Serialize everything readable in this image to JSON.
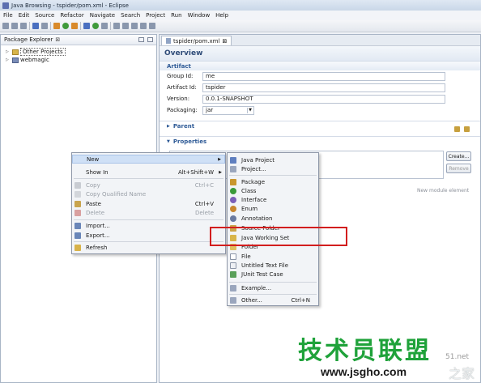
{
  "window": {
    "title": "Java Browsing - tspider/pom.xml - Eclipse"
  },
  "menubar": [
    "File",
    "Edit",
    "Source",
    "Refactor",
    "Navigate",
    "Search",
    "Project",
    "Run",
    "Window",
    "Help"
  ],
  "explorer": {
    "title": "Package Explorer",
    "close": "⊠",
    "tree": [
      {
        "label": "Other Projects",
        "selected": true
      },
      {
        "label": "webmagic",
        "selected": false
      }
    ]
  },
  "editor": {
    "tab": {
      "label": "tspider/pom.xml",
      "close": "⊠"
    },
    "heading": "Overview",
    "artifact": {
      "title": "Artifact",
      "group_id_label": "Group Id:",
      "group_id_value": "me",
      "artifact_id_label": "Artifact Id:",
      "artifact_id_value": "tspider",
      "version_label": "Version:",
      "version_value": "0.0.1-SNAPSHOT",
      "packaging_label": "Packaging:",
      "packaging_value": "jar"
    },
    "parent_title": "Parent",
    "properties_title": "Properties",
    "create_btn": "Create...",
    "remove_btn": "Remove",
    "new_module_hint": "New module element"
  },
  "context_menu": {
    "items": [
      {
        "label": "New",
        "submenu": true
      },
      {
        "label": "Show In",
        "accel": "Alt+Shift+W",
        "submenu": true
      },
      {
        "label": "Copy",
        "accel": "Ctrl+C",
        "disabled": true
      },
      {
        "label": "Copy Qualified Name",
        "disabled": true
      },
      {
        "label": "Paste",
        "accel": "Ctrl+V"
      },
      {
        "label": "Delete",
        "accel": "Delete",
        "disabled": true
      },
      {
        "label": "Import..."
      },
      {
        "label": "Export..."
      },
      {
        "label": "Refresh"
      }
    ]
  },
  "new_submenu": {
    "items": [
      {
        "label": "Java Project"
      },
      {
        "label": "Project..."
      },
      {
        "label": "Package"
      },
      {
        "label": "Class"
      },
      {
        "label": "Interface"
      },
      {
        "label": "Enum"
      },
      {
        "label": "Annotation"
      },
      {
        "label": "Source Folder"
      },
      {
        "label": "Java Working Set"
      },
      {
        "label": "Folder"
      },
      {
        "label": "File"
      },
      {
        "label": "Untitled Text File"
      },
      {
        "label": "JUnit Test Case"
      },
      {
        "label": "Example..."
      },
      {
        "label": "Other...",
        "accel": "Ctrl+N"
      }
    ]
  },
  "watermark": {
    "big": "技术员联盟",
    "url": "www.jsgho.com",
    "corner_text": "51.net",
    "home_text": "之家"
  },
  "colors": {
    "highlight": "#d21e1e",
    "watermark_green": "#1fa23a",
    "section_blue": "#2e5a96"
  }
}
